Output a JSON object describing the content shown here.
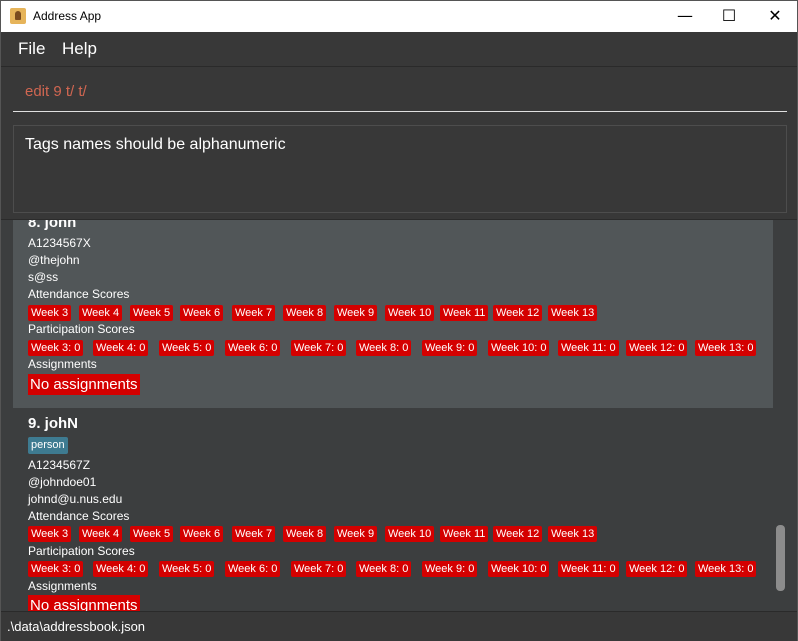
{
  "window": {
    "title": "Address App",
    "minimize_glyph": "—",
    "maximize_glyph": "☐",
    "close_glyph": "✕"
  },
  "menu": {
    "file": "File",
    "help": "Help"
  },
  "command": {
    "value": "edit 9 t/ t/"
  },
  "result": {
    "message": "Tags names should be alphanumeric"
  },
  "persons": [
    {
      "index_name": "8.  john",
      "tags": [],
      "student_id": "A1234567X",
      "telegram": "@thejohn",
      "email": "s@ss",
      "attendance_label": "Attendance Scores",
      "attendance": [
        "Week 3",
        "Week 4",
        "Week 5",
        "Week 6",
        "Week 7",
        "Week 8",
        "Week 9",
        "Week 10",
        "Week 11",
        "Week 12",
        "Week 13"
      ],
      "participation_label": "Participation Scores",
      "participation": [
        "Week 3: 0",
        "Week 4: 0",
        "Week 5: 0",
        "Week 6: 0",
        "Week 7: 0",
        "Week 8: 0",
        "Week 9: 0",
        "Week 10: 0",
        "Week 11: 0",
        "Week 12: 0",
        "Week 13: 0"
      ],
      "assignments_label": "Assignments",
      "assignments_value": "No assignments"
    },
    {
      "index_name": "9.  johN",
      "tags": [
        "person"
      ],
      "student_id": "A1234567Z",
      "telegram": "@johndoe01",
      "email": "johnd@u.nus.edu",
      "attendance_label": "Attendance Scores",
      "attendance": [
        "Week 3",
        "Week 4",
        "Week 5",
        "Week 6",
        "Week 7",
        "Week 8",
        "Week 9",
        "Week 10",
        "Week 11",
        "Week 12",
        "Week 13"
      ],
      "participation_label": "Participation Scores",
      "participation": [
        "Week 3: 0",
        "Week 4: 0",
        "Week 5: 0",
        "Week 6: 0",
        "Week 7: 0",
        "Week 8: 0",
        "Week 9: 0",
        "Week 10: 0",
        "Week 11: 0",
        "Week 12: 0",
        "Week 13: 0"
      ],
      "assignments_label": "Assignments",
      "assignments_value": "No assignments"
    }
  ],
  "status": {
    "file_path": ".\\data\\addressbook.json"
  },
  "colors": {
    "chip": "#d40000",
    "tag": "#3e7b91",
    "selected_card": "#515658",
    "command_text": "#d06651"
  }
}
